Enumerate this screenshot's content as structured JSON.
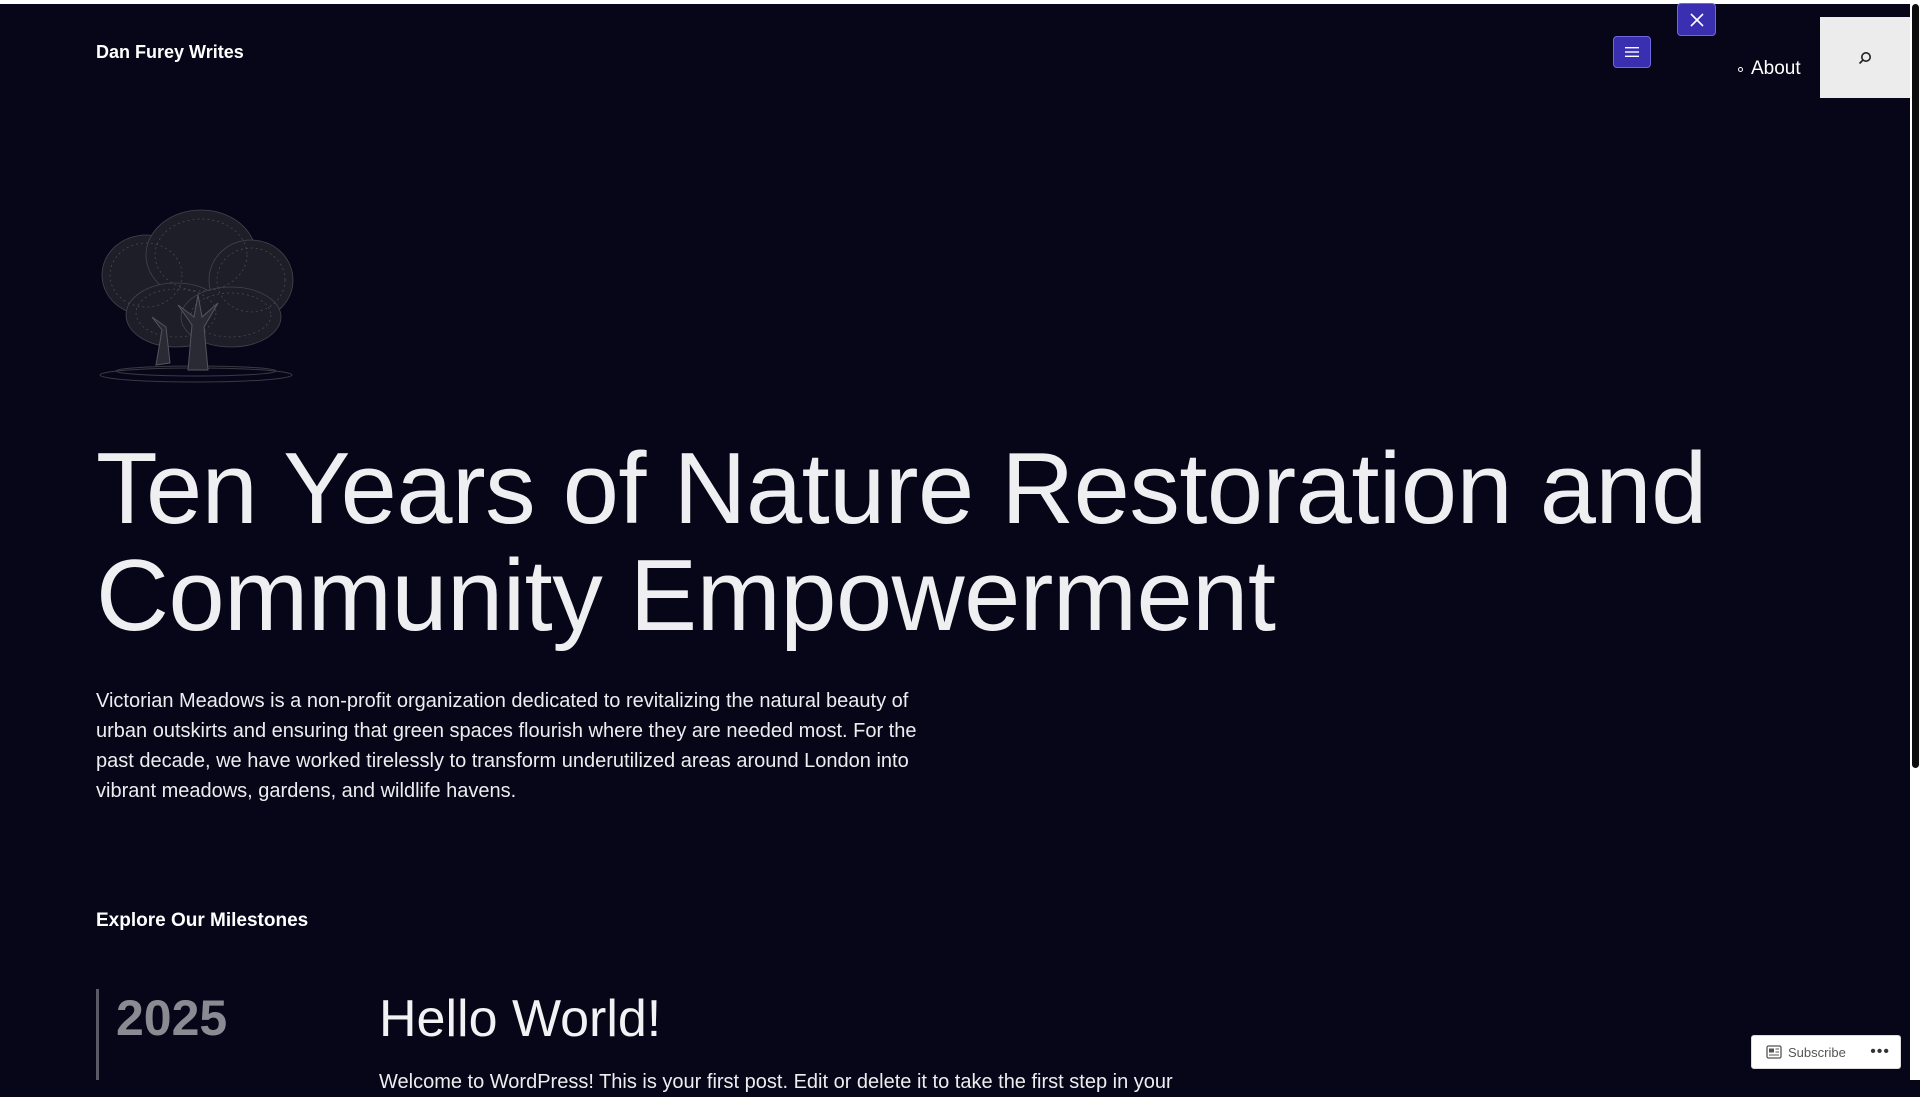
{
  "site": {
    "title": "Dan Furey Writes"
  },
  "nav": {
    "open_menu_icon": "hamburger-icon",
    "close_menu_icon": "close-icon",
    "items": [
      {
        "label": "About"
      }
    ],
    "search_icon": "search-icon"
  },
  "hero": {
    "image_icon": "tree-illustration",
    "headline": "Ten Years of Nature Restoration and Community Empowerment",
    "intro": "Victorian Meadows is a non-profit organization dedicated to revitalizing the natural beauty of urban outskirts and ensuring that green spaces flourish where they are needed most. For the past decade, we have worked tirelessly to transform underutilized areas around London into vibrant meadows, gardens, and wildlife havens."
  },
  "milestones": {
    "heading": "Explore Our Milestones",
    "entries": [
      {
        "year": "2025",
        "title": "Hello World!",
        "excerpt": "Welcome to WordPress! This is your first post. Edit or delete it to take the first step in your"
      }
    ]
  },
  "subscribe": {
    "label": "Subscribe",
    "more": "•••"
  },
  "colors": {
    "background": "#070618",
    "accent_button": "#3a2fb0",
    "text": "#ededf0"
  }
}
